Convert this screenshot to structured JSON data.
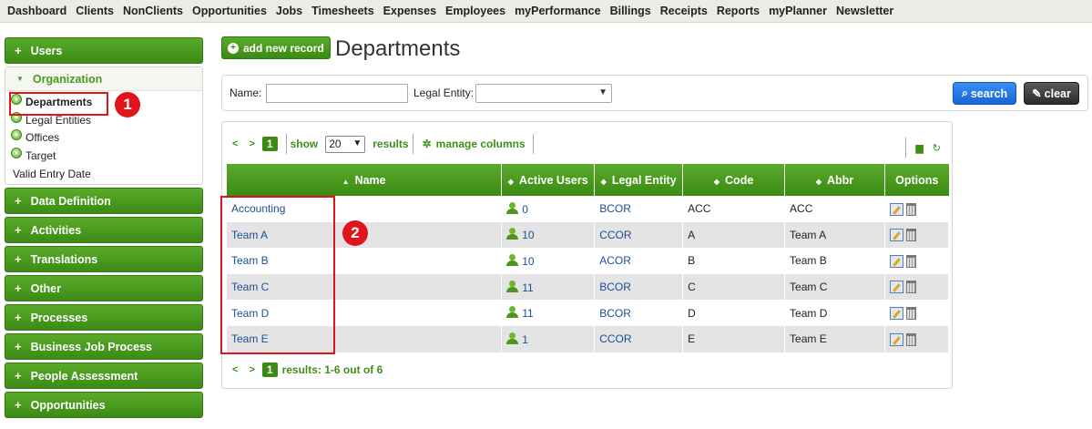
{
  "topnav": [
    "Dashboard",
    "Clients",
    "NonClients",
    "Opportunities",
    "Jobs",
    "Timesheets",
    "Expenses",
    "Employees",
    "myPerformance",
    "Billings",
    "Receipts",
    "Reports",
    "myPlanner",
    "Newsletter"
  ],
  "sidebar": {
    "sections_top": [
      "Users"
    ],
    "organization": {
      "title": "Organization",
      "items": [
        "Departments",
        "Legal Entities",
        "Offices",
        "Target",
        "Valid Entry Date"
      ]
    },
    "sections_bottom": [
      "Data Definition",
      "Activities",
      "Translations",
      "Other",
      "Processes",
      "Business Job Process",
      "People Assessment",
      "Opportunities"
    ]
  },
  "callouts": [
    "1",
    "2"
  ],
  "main": {
    "add_button": "add new record",
    "title": "Departments"
  },
  "filter": {
    "name_label": "Name:",
    "name_value": "",
    "legal_entity_label": "Legal Entity:",
    "legal_entity_value": "",
    "search_label": "search",
    "clear_label": "clear"
  },
  "grid": {
    "pager_top": {
      "prev": "<",
      "next": ">",
      "page": "1",
      "show_label": "show",
      "show_value": "20",
      "results_label": "results",
      "manage_columns": "manage columns"
    },
    "pager_bottom": {
      "prev": "<",
      "next": ">",
      "page": "1",
      "results_text": "results: 1-6 out of 6"
    },
    "columns": [
      "Name",
      "Active Users",
      "Legal Entity",
      "Code",
      "Abbr",
      "Options"
    ],
    "rows": [
      {
        "name": "Accounting",
        "active_users": "0",
        "legal_entity": "BCOR",
        "code": "ACC",
        "abbr": "ACC"
      },
      {
        "name": "Team A",
        "active_users": "10",
        "legal_entity": "CCOR",
        "code": "A",
        "abbr": "Team A"
      },
      {
        "name": "Team B",
        "active_users": "10",
        "legal_entity": "ACOR",
        "code": "B",
        "abbr": "Team B"
      },
      {
        "name": "Team C",
        "active_users": "11",
        "legal_entity": "BCOR",
        "code": "C",
        "abbr": "Team C"
      },
      {
        "name": "Team D",
        "active_users": "11",
        "legal_entity": "BCOR",
        "code": "D",
        "abbr": "Team D"
      },
      {
        "name": "Team E",
        "active_users": "1",
        "legal_entity": "CCOR",
        "code": "E",
        "abbr": "Team E"
      }
    ]
  }
}
